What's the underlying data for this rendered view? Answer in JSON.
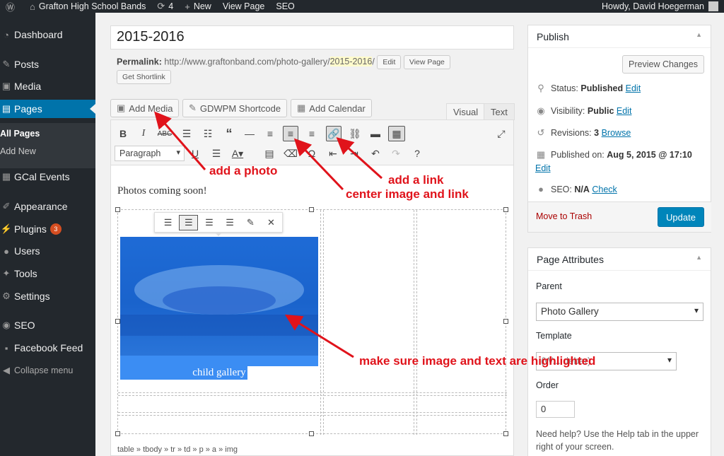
{
  "adminbar": {
    "site_name": "Grafton High School Bands",
    "updates_count": "4",
    "new_label": "New",
    "view_page": "View Page",
    "seo": "SEO",
    "howdy": "Howdy, David Hoegerman"
  },
  "sidebar": {
    "dashboard": "Dashboard",
    "posts": "Posts",
    "media": "Media",
    "pages": "Pages",
    "all_pages": "All Pages",
    "add_new": "Add New",
    "gcal": "GCal Events",
    "appearance": "Appearance",
    "plugins": "Plugins",
    "plugins_badge": "3",
    "users": "Users",
    "tools": "Tools",
    "settings": "Settings",
    "seo": "SEO",
    "facebook": "Facebook Feed",
    "collapse": "Collapse menu"
  },
  "editor": {
    "title": "2015-2016",
    "permalink_label": "Permalink:",
    "permalink_base": "http://www.graftonband.com/photo-gallery/",
    "permalink_slug": "2015-2016",
    "permalink_end": "/",
    "edit_btn": "Edit",
    "view_page_btn": "View Page",
    "shortlink_btn": "Get Shortlink",
    "add_media": "Add Media",
    "shortcode": "GDWPM Shortcode",
    "add_calendar": "Add Calendar",
    "tab_visual": "Visual",
    "tab_text": "Text",
    "format_select": "Paragraph",
    "content_text": "Photos coming soon!",
    "caption": "child gallery",
    "path": "table » tbody » tr » td » p » a » img"
  },
  "annotations": {
    "add_photo": "add a photo",
    "add_link": "add a link",
    "center": "center image and link",
    "highlight": "make sure image and text are highlighted"
  },
  "publish": {
    "title": "Publish",
    "preview": "Preview Changes",
    "status_label": "Status:",
    "status_value": "Published",
    "visibility_label": "Visibility:",
    "visibility_value": "Public",
    "revisions_label": "Revisions:",
    "revisions_value": "3",
    "browse": "Browse",
    "published_label": "Published on:",
    "published_value": "Aug 5, 2015 @ 17:10",
    "edit": "Edit",
    "seo_label": "SEO:",
    "seo_value": "N/A",
    "check": "Check",
    "trash": "Move to Trash",
    "update": "Update"
  },
  "attributes": {
    "title": "Page Attributes",
    "parent_label": "Parent",
    "parent_value": "Photo Gallery",
    "template_label": "Template",
    "template_value": "(W... debar)",
    "order_label": "Order",
    "order_value": "0",
    "help": "Need help? Use the Help tab in the upper right of your screen."
  },
  "colors": {
    "admin_dark": "#23282d",
    "accent_blue": "#0073aa",
    "annotation_red": "#e0131b",
    "selection_blue": "#3b8df3"
  }
}
